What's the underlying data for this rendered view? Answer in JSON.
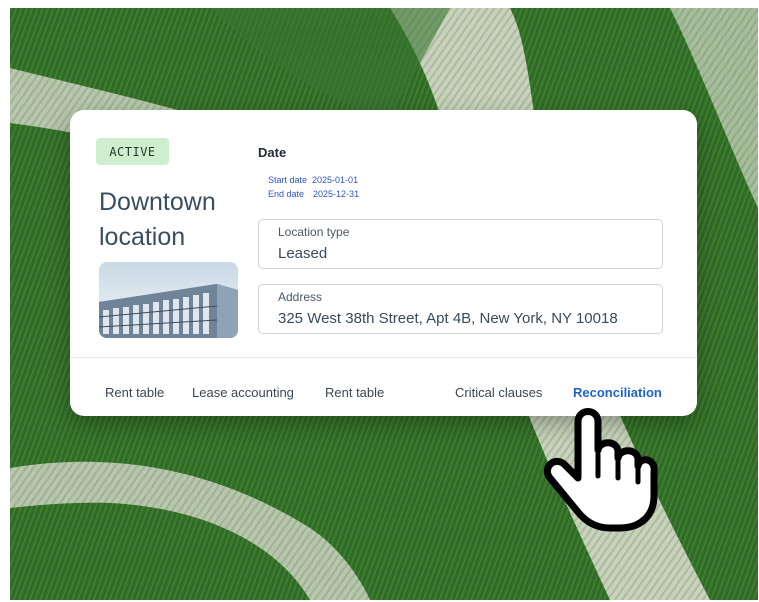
{
  "status_badge": "ACTIVE",
  "location": {
    "title": "Downtown location"
  },
  "date": {
    "label": "Date",
    "start_label": "Start date",
    "start_value": "2025-01-01",
    "end_label": "End date",
    "end_value": "2025-12-31"
  },
  "fields": {
    "location_type": {
      "label": "Location type",
      "value": "Leased"
    },
    "address": {
      "label": "Address",
      "value": "325 West 38th Street, Apt 4B, New York, NY 10018"
    }
  },
  "tabs": [
    {
      "label": "Rent table"
    },
    {
      "label": "Lease accounting"
    },
    {
      "label": "Rent table"
    },
    {
      "label": "Critical clauses"
    },
    {
      "label": "Reconciliation",
      "active": true
    }
  ],
  "colors": {
    "badge_bg": "#cfeecd",
    "active_tab": "#1f64c4",
    "title": "#3a4e62"
  }
}
